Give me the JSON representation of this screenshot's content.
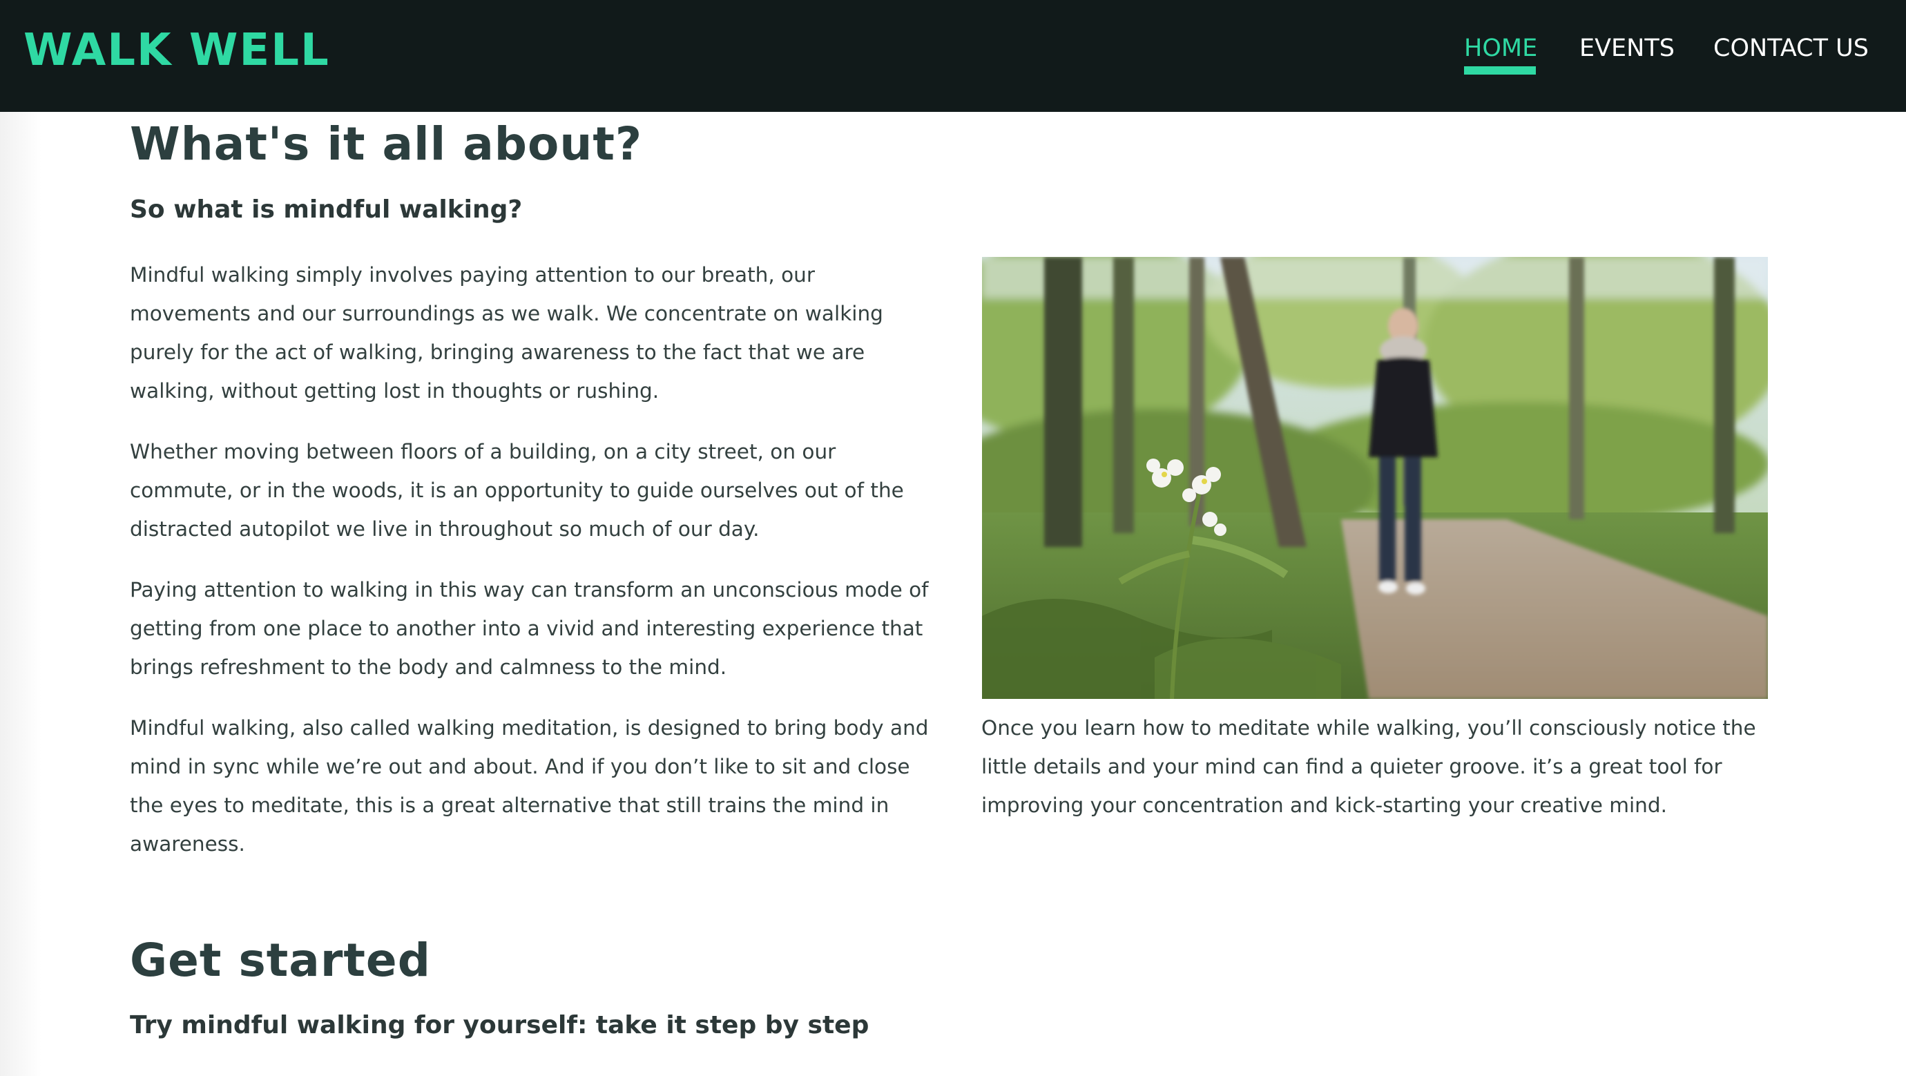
{
  "header": {
    "brand": "WALK WELL",
    "nav": [
      {
        "label": "HOME",
        "active": true
      },
      {
        "label": "EVENTS",
        "active": false
      },
      {
        "label": "CONTACT US",
        "active": false
      }
    ]
  },
  "colors": {
    "accent": "#2fd9a3",
    "header_bg": "#111a1a",
    "heading": "#2c3f3f"
  },
  "about": {
    "title": "What's it all about?",
    "subtitle": "So what is mindful walking?",
    "paragraphs": [
      "Mindful walking simply involves paying attention to our breath, our movements and our surroundings as we walk. We concentrate on walking purely for the act of walking, bringing awareness to the fact that we are walking, without getting lost in thoughts or rushing.",
      "Whether moving between floors of a building, on a city street, on our commute, or in the woods, it is an opportunity to guide ourselves out of the distracted autopilot we live in throughout so much of our day.",
      "Paying attention to walking in this way can transform an unconscious mode of getting from one place to another into a vivid and interesting experience that brings refreshment to the body and calmness to the mind.",
      "Mindful walking, also called walking meditation, is designed to bring body and mind in sync while we’re out and about. And if you don’t like to sit and close the eyes to meditate, this is a great alternative that still trains the mind in awareness."
    ],
    "image_paragraph": "Once you learn how to meditate while walking, you’ll consciously notice the little details and your mind can find a quieter groove. it’s a great tool for improving your concentration and kick-starting your creative mind."
  },
  "get_started": {
    "title": "Get started",
    "subtitle": "Try mindful walking for yourself: take it step by step"
  }
}
